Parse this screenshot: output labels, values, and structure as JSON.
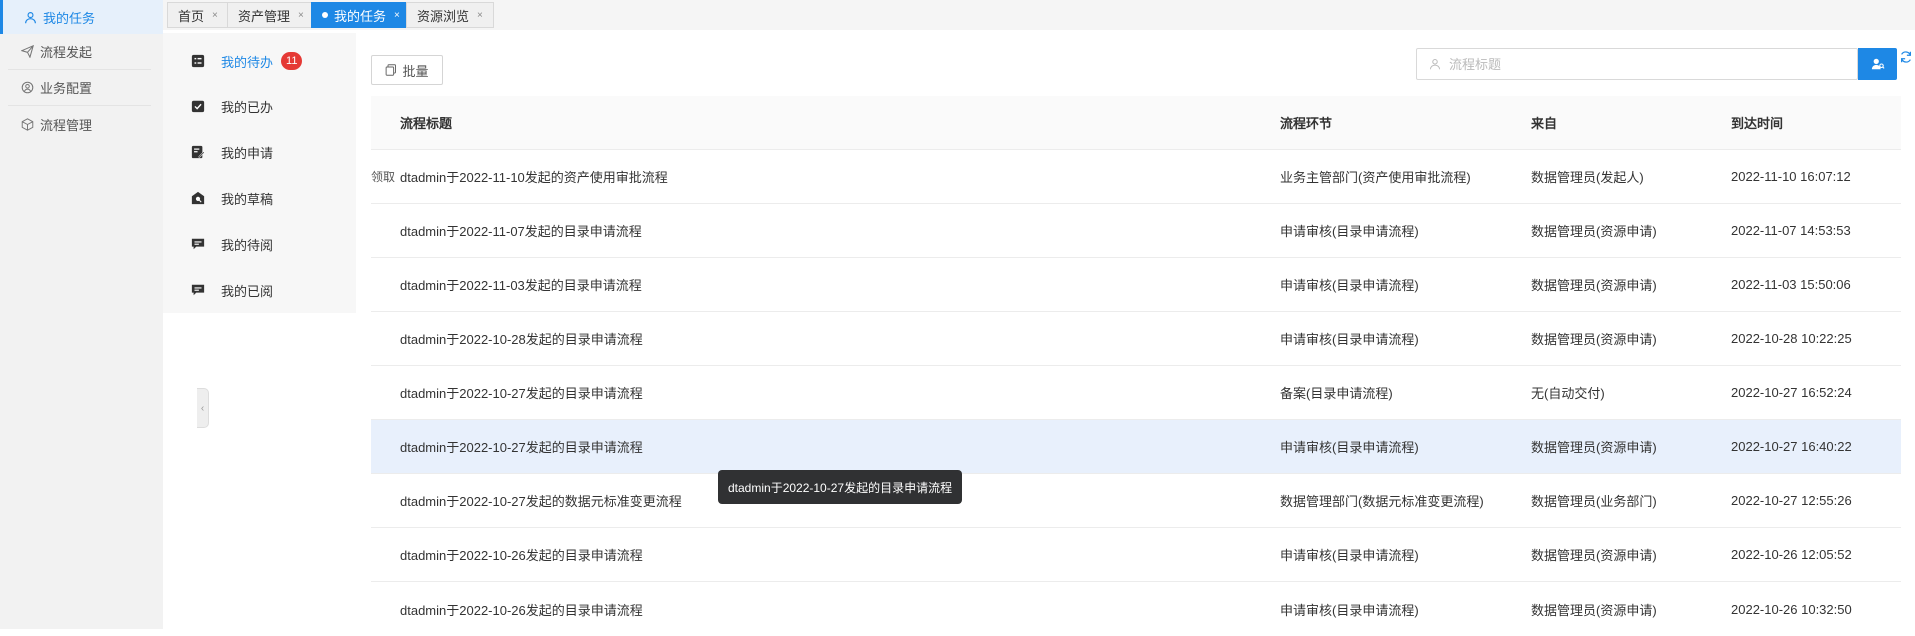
{
  "leftnav": {
    "items": [
      {
        "label": "我的任务",
        "icon": "user-icon",
        "active": true
      },
      {
        "label": "流程发起",
        "icon": "send-icon"
      },
      {
        "label": "业务配置",
        "icon": "user-circle-icon"
      },
      {
        "label": "流程管理",
        "icon": "cube-icon"
      }
    ]
  },
  "tabs": [
    {
      "label": "首页",
      "close": "×"
    },
    {
      "label": "资产管理",
      "close": "×"
    },
    {
      "label": "我的任务",
      "close": "×",
      "active": true
    },
    {
      "label": "资源浏览",
      "close": "×"
    }
  ],
  "subnav": {
    "items": [
      {
        "label": "我的待办",
        "badge": "11",
        "active": true
      },
      {
        "label": "我的已办"
      },
      {
        "label": "我的申请"
      },
      {
        "label": "我的草稿"
      },
      {
        "label": "我的待阅"
      },
      {
        "label": "我的已阅"
      }
    ]
  },
  "toolbar": {
    "batch_label": "批量",
    "search_placeholder": "流程标题"
  },
  "table": {
    "headers": [
      "流程标题",
      "流程环节",
      "来自",
      "到达时间"
    ],
    "claim_label": "领取",
    "rows": [
      {
        "title": "dtadmin于2022-11-10发起的资产使用审批流程",
        "step": "业务主管部门(资产使用审批流程)",
        "from": "数据管理员(发起人)",
        "time": "2022-11-10 16:07:12"
      },
      {
        "title": "dtadmin于2022-11-07发起的目录申请流程",
        "step": "申请审核(目录申请流程)",
        "from": "数据管理员(资源申请)",
        "time": "2022-11-07 14:53:53"
      },
      {
        "title": "dtadmin于2022-11-03发起的目录申请流程",
        "step": "申请审核(目录申请流程)",
        "from": "数据管理员(资源申请)",
        "time": "2022-11-03 15:50:06"
      },
      {
        "title": "dtadmin于2022-10-28发起的目录申请流程",
        "step": "申请审核(目录申请流程)",
        "from": "数据管理员(资源申请)",
        "time": "2022-10-28 10:22:25"
      },
      {
        "title": "dtadmin于2022-10-27发起的目录申请流程",
        "step": "备案(目录申请流程)",
        "from": "无(自动交付)",
        "time": "2022-10-27 16:52:24"
      },
      {
        "title": "dtadmin于2022-10-27发起的目录申请流程",
        "step": "申请审核(目录申请流程)",
        "from": "数据管理员(资源申请)",
        "time": "2022-10-27 16:40:22"
      },
      {
        "title": "dtadmin于2022-10-27发起的数据元标准变更流程",
        "step": "数据管理部门(数据元标准变更流程)",
        "from": "数据管理员(业务部门)",
        "time": "2022-10-27 12:55:26"
      },
      {
        "title": "dtadmin于2022-10-26发起的目录申请流程",
        "step": "申请审核(目录申请流程)",
        "from": "数据管理员(资源申请)",
        "time": "2022-10-26 12:05:52"
      },
      {
        "title": "dtadmin于2022-10-26发起的目录申请流程",
        "step": "申请审核(目录申请流程)",
        "from": "数据管理员(资源申请)",
        "time": "2022-10-26 10:32:50"
      }
    ]
  },
  "tooltip": {
    "text": "dtadmin于2022-10-27发起的目录申请流程"
  },
  "colors": {
    "accent": "#1e88e5",
    "badge": "#e53935",
    "row_hover": "#e8f0fc"
  }
}
